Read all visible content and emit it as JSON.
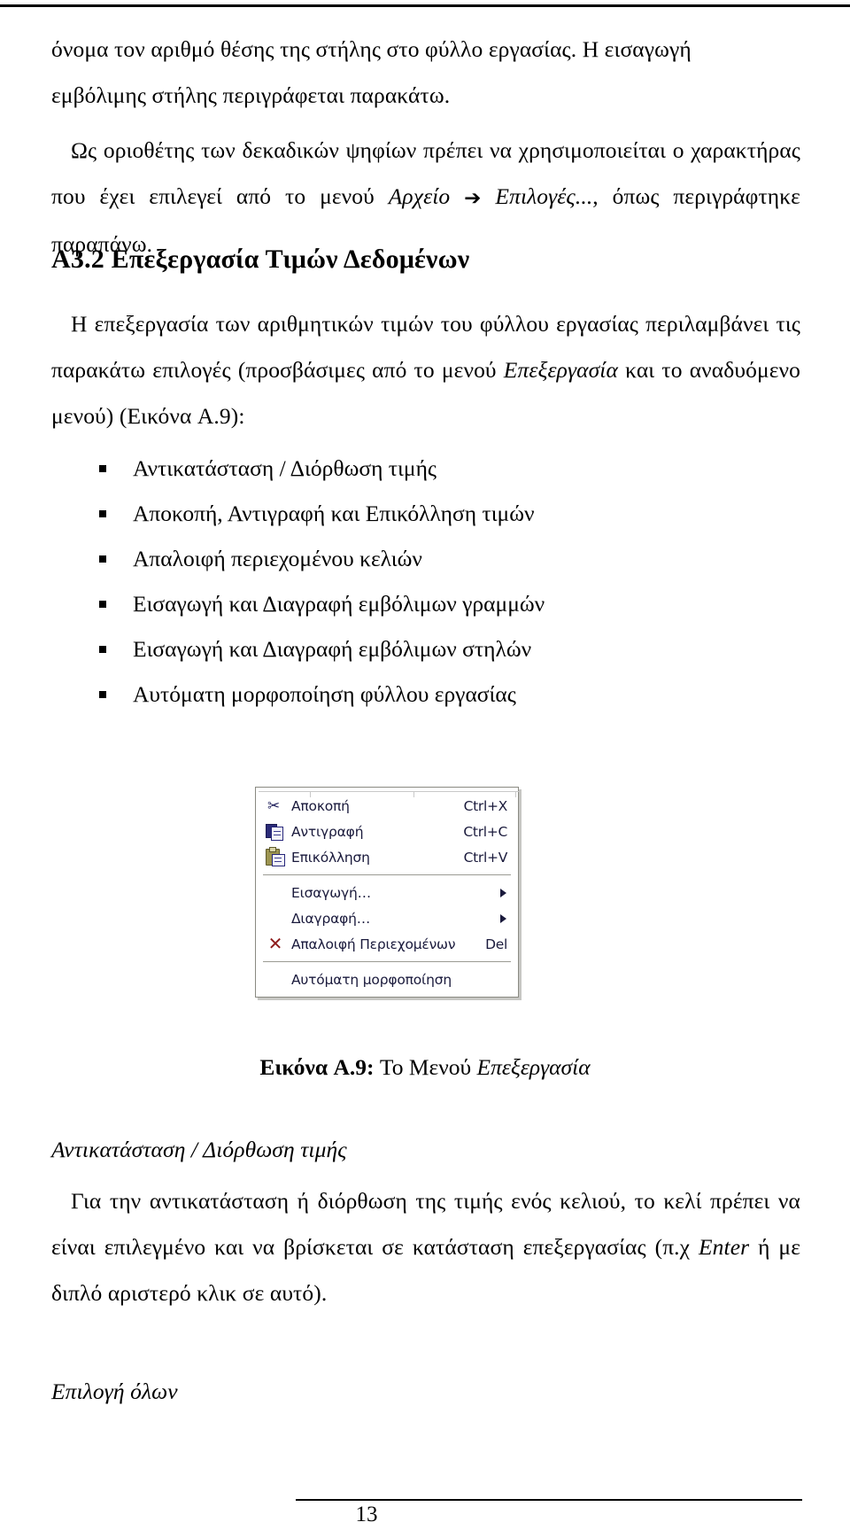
{
  "document": {
    "page_number": "13"
  },
  "paragraphs": {
    "intro_continued_1": "όνομα τον αριθμό θέσης της στήλης στο φύλλο εργασίας. Η εισαγωγή",
    "intro_continued_2": "εμβόλιμης στήλης περιγράφεται παρακάτω.",
    "decimal_sep_a": "Ως οριοθέτης των δεκαδικών ψηφίων πρέπει να χρησιμοποιείται ο χαρακτήρας που έχει επιλεγεί από το μενού ",
    "decimal_sep_menu_1": "Αρχείο",
    "decimal_sep_arrow": "➔",
    "decimal_sep_menu_2": "Επιλογές...",
    "decimal_sep_b": ", όπως περιγράφτηκε παραπάνω."
  },
  "section": {
    "number": "A3.2",
    "title": "Επεξεργασία Τιμών Δεδομένων",
    "heading_full": "A3.2 Επεξεργασία Τιμών Δεδομένων",
    "lead_a": "Η επεξεργασία των αριθμητικών τιμών του φύλλου εργασίας περιλαμβάνει τις παρακάτω επιλογές (προσβάσιμες από το μενού ",
    "lead_menu": "Επεξεργασία",
    "lead_b": " και το αναδυόμενο μενού) (Εικόνα A.9):"
  },
  "bullets": [
    "Αντικατάσταση / Διόρθωση τιμής",
    "Αποκοπή, Αντιγραφή και Επικόλληση τιμών",
    "Απαλοιφή περιεχομένου κελιών",
    "Εισαγωγή και Διαγραφή εμβόλιμων γραμμών",
    "Εισαγωγή και Διαγραφή εμβόλιμων στηλών",
    "Αυτόματη μορφοποίηση φύλλου εργασίας"
  ],
  "edit_menu": {
    "items": [
      {
        "icon": "scissors-icon",
        "label": "Αποκοπή",
        "accel": "Ctrl+X",
        "submenu": false
      },
      {
        "icon": "copy-icon",
        "label": "Αντιγραφή",
        "accel": "Ctrl+C",
        "submenu": false
      },
      {
        "icon": "paste-icon",
        "label": "Επικόλληση",
        "accel": "Ctrl+V",
        "submenu": false
      },
      {
        "icon": "none",
        "label": "Εισαγωγή…",
        "accel": "",
        "submenu": true
      },
      {
        "icon": "none",
        "label": "Διαγραφή…",
        "accel": "",
        "submenu": true
      },
      {
        "icon": "red-x-icon",
        "label": "Απαλοιφή Περιεχομένων",
        "accel": "Del",
        "submenu": false
      },
      {
        "icon": "none",
        "label": "Αυτόματη μορφοποίηση",
        "accel": "",
        "submenu": false
      }
    ],
    "text_color": "#1a1a3c",
    "border_color": "#8a8a82",
    "separator_color": "#9b9b93"
  },
  "figure_caption": {
    "label": "Εικόνα A.9:",
    "text": " Το Μενού ",
    "italic_part": "Επεξεργασία"
  },
  "subsections": {
    "replace_title": "Αντικατάσταση / Διόρθωση τιμής",
    "replace_body_a": "Για την αντικατάσταση ή διόρθωση της τιμής ενός κελιού, το κελί πρέπει να είναι επιλεγμένο και να βρίσκεται σε κατάσταση επεξεργασίας (π.χ ",
    "replace_body_key": "Enter",
    "replace_body_b": " ή με διπλό αριστερό κλικ σε αυτό).",
    "select_all_title": "Επιλογή όλων"
  }
}
